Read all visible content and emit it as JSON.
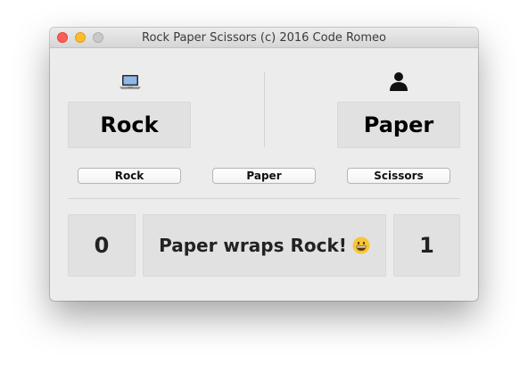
{
  "window": {
    "title": "Rock Paper Scissors (c) 2016 Code Romeo"
  },
  "computer": {
    "icon": "laptop-icon",
    "choice": "Rock"
  },
  "player": {
    "icon": "person-icon",
    "choice": "Paper"
  },
  "buttons": {
    "rock_label": "Rock",
    "paper_label": "Paper",
    "scissors_label": "Scissors"
  },
  "score": {
    "computer": "0",
    "player": "1",
    "result_text": "Paper wraps Rock!",
    "result_icon": "grinning-face-emoji"
  },
  "colors": {
    "window_bg": "#ececec",
    "box_bg": "#e1e1e1",
    "close": "#fc5f57",
    "minimize": "#fdbc2e",
    "zoom": "#c9c9c9"
  }
}
